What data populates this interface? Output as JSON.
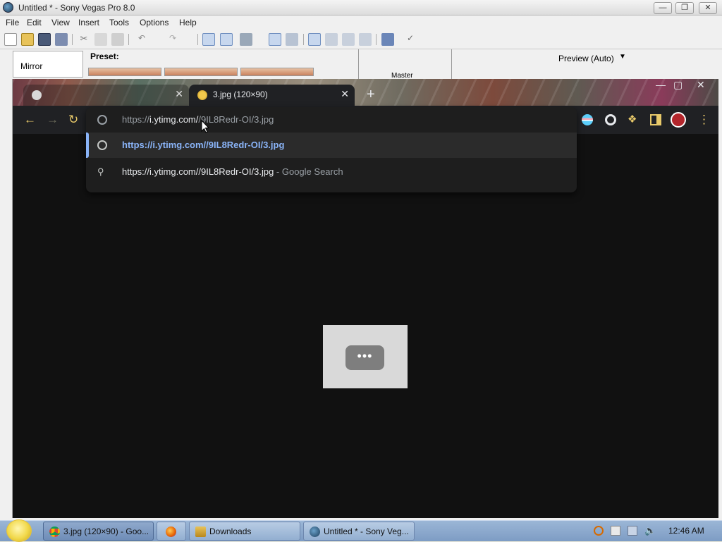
{
  "vegas": {
    "title": "Untitled * - Sony Vegas Pro 8.0",
    "menu": [
      "File",
      "Edit",
      "View",
      "Insert",
      "Tools",
      "Options",
      "Help"
    ],
    "fx_list": [
      "Mirror"
    ],
    "preset_label": "Preset:",
    "preview_label": "Preview (Auto)",
    "master_label": "Master"
  },
  "chrome": {
    "tabs": [
      {
        "title": "3.jpg (120×90)",
        "active": true
      }
    ],
    "omnibox": {
      "input_prefix": "https://",
      "input_host": "i.ytimg.com/",
      "input_rest": "/9IL8Redr-OI/3.jpg",
      "suggestions": [
        {
          "icon": "globe-icon",
          "text": "https://i.ytimg.com//9IL8Redr-OI/3.jpg",
          "suffix": "",
          "selected": true
        },
        {
          "icon": "search-icon",
          "text": "https://i.ytimg.com//9IL8Redr-OI/3.jpg",
          "suffix": " - Google Search",
          "selected": false
        }
      ]
    },
    "image_placeholder_label": "•••"
  },
  "taskbar": {
    "items": [
      {
        "label": "3.jpg (120×90) - Goo...",
        "icon": "chrome-icon",
        "active": true
      },
      {
        "label": "",
        "icon": "firefox-icon",
        "active": false
      },
      {
        "label": "Downloads",
        "icon": "folder-icon",
        "active": false
      },
      {
        "label": "Untitled * - Sony Veg...",
        "icon": "vegas-icon",
        "active": false
      }
    ],
    "clock": "12:46 AM"
  }
}
